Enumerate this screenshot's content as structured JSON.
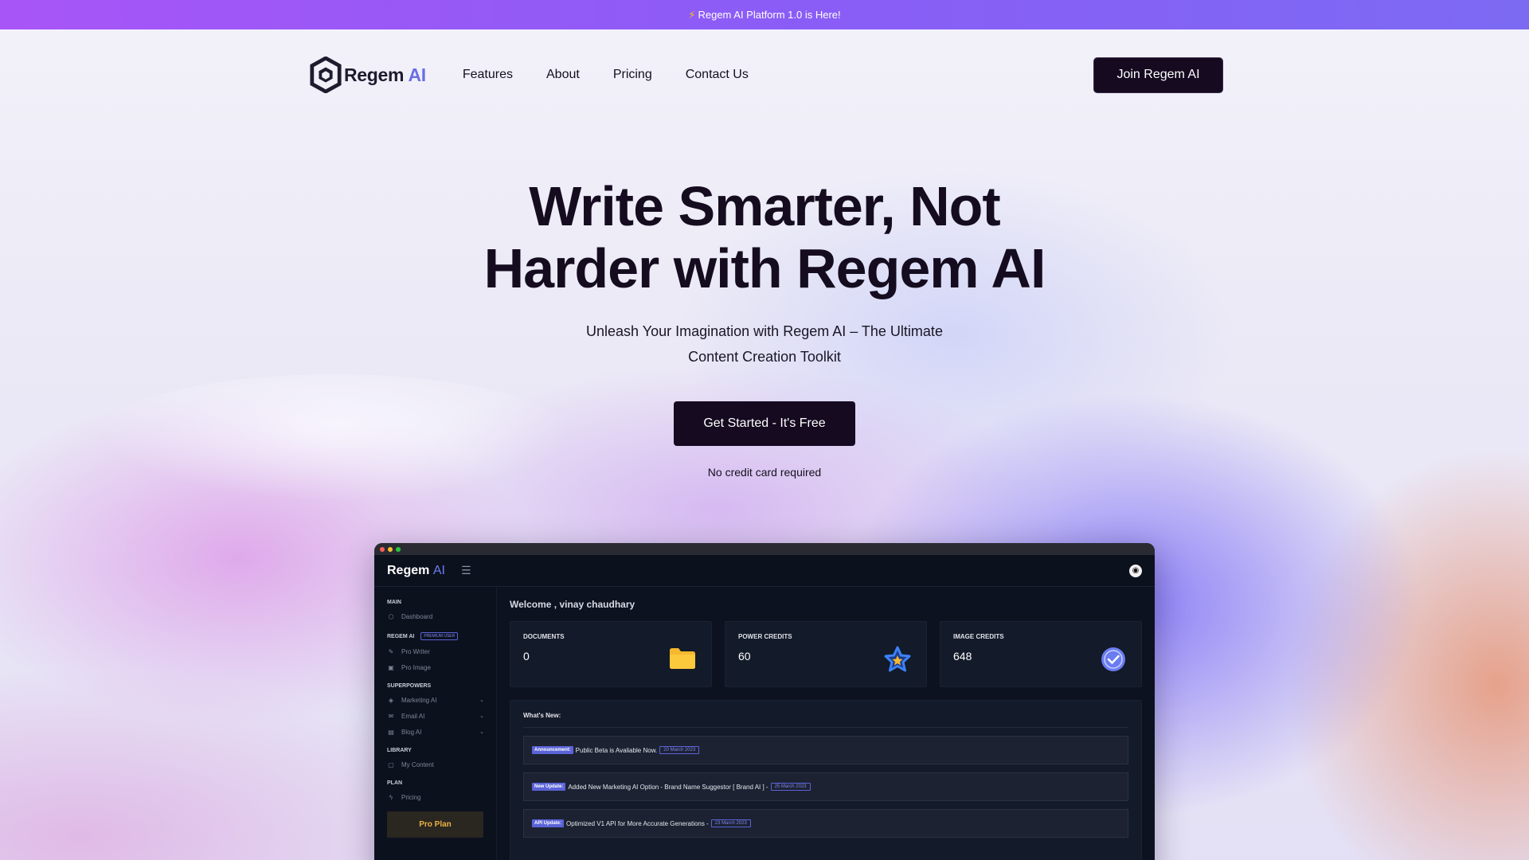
{
  "announcement": {
    "icon": "lightning-icon",
    "text": "Regem AI Platform 1.0 is Here!"
  },
  "nav": {
    "logo": {
      "name": "Regem",
      "suffix": "AI"
    },
    "links": [
      "Features",
      "About",
      "Pricing",
      "Contact Us"
    ],
    "cta": "Join Regem AI"
  },
  "hero": {
    "title_line1": "Write Smarter, Not",
    "title_line2": "Harder with Regem AI",
    "subtitle": "Unleash Your Imagination with Regem AI – The Ultimate Content Creation Toolkit",
    "cta": "Get Started - It's Free",
    "note": "No credit card required"
  },
  "app": {
    "logo": {
      "name": "Regem",
      "suffix": "AI"
    },
    "sidebar": {
      "sections": [
        {
          "title": "MAIN",
          "items": [
            {
              "label": "Dashboard",
              "icon": "dashboard-icon"
            }
          ]
        },
        {
          "title": "REGEM AI",
          "badge": "PREMIUM USER",
          "items": [
            {
              "label": "Pro Writer",
              "icon": "pen-icon"
            },
            {
              "label": "Pro Image",
              "icon": "image-icon"
            }
          ]
        },
        {
          "title": "SUPERPOWERS",
          "items": [
            {
              "label": "Marketing AI",
              "icon": "layers-icon",
              "expandable": true
            },
            {
              "label": "Email AI",
              "icon": "mail-icon",
              "expandable": true
            },
            {
              "label": "Blog AI",
              "icon": "document-icon",
              "expandable": true
            }
          ]
        },
        {
          "title": "LIBRARY",
          "items": [
            {
              "label": "My Content",
              "icon": "folder-icon"
            }
          ]
        },
        {
          "title": "PLAN",
          "items": [
            {
              "label": "Pricing",
              "icon": "bolt-icon"
            }
          ]
        }
      ],
      "plan_button": "Pro Plan"
    },
    "welcome": "Welcome , vinay chaudhary",
    "stats": [
      {
        "label": "DOCUMENTS",
        "value": "0",
        "icon": "folder-icon",
        "color": "#f5b82e"
      },
      {
        "label": "POWER CREDITS",
        "value": "60",
        "icon": "star-icon",
        "color": "#3b82f6"
      },
      {
        "label": "IMAGE CREDITS",
        "value": "648",
        "icon": "verified-badge-icon",
        "color": "#6a7cf0"
      }
    ],
    "news": {
      "title": "What's New:",
      "items": [
        {
          "tag": "Announcement:",
          "text": "Public Beta is Avaliable Now.",
          "date": "20 March 2023"
        },
        {
          "tag": "New Update:",
          "text": "Added New Marketing AI Option - Brand Name Suggestor [ Brand AI ] -",
          "date": "25 March 2023"
        },
        {
          "tag": "API Update:",
          "text": "Optimized V1 API for More Accurate Generations -",
          "date": "23 March 2023"
        }
      ]
    }
  },
  "colors": {
    "brand_dark": "#150a20",
    "accent": "#6a6ee6",
    "gradient_start": "#a855f7",
    "gradient_end": "#7c6af3"
  }
}
